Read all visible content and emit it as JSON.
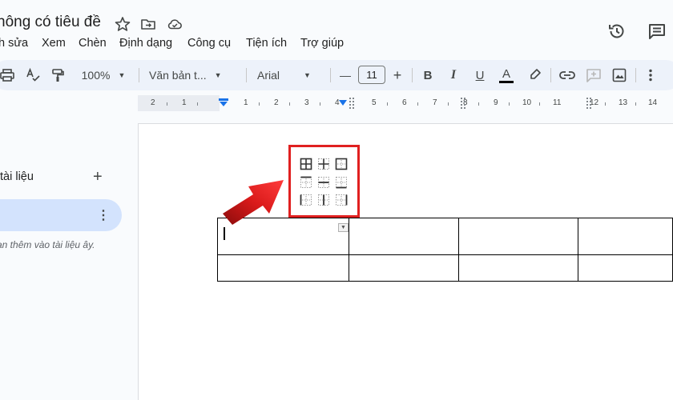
{
  "header": {
    "title": "hông có tiêu đề"
  },
  "menu": [
    {
      "label": "h sửa"
    },
    {
      "label": "Xem"
    },
    {
      "label": "Chèn"
    },
    {
      "label": "Định dạng"
    },
    {
      "label": "Công cụ"
    },
    {
      "label": "Tiện ích"
    },
    {
      "label": "Trợ giúp"
    }
  ],
  "toolbar": {
    "zoom": "100%",
    "style": "Văn bản t...",
    "font": "Arial",
    "font_size": "11",
    "minus": "—",
    "plus": "+",
    "bold": "B",
    "italic": "I",
    "underline": "U",
    "text_color_label": "A",
    "text_color": "#000000"
  },
  "ruler": {
    "numbers": [
      "2",
      "1",
      "1",
      "2",
      "3",
      "4",
      "5",
      "6",
      "7",
      "8",
      "9",
      "10",
      "11",
      "12",
      "13",
      "14"
    ]
  },
  "sidebar": {
    "section_label": "tài liệu",
    "add": "+",
    "more": "⋮",
    "hint": "ạn thêm vào tài liệu ây."
  },
  "colors": {
    "accent_blue": "#1a73e8",
    "highlight_red": "#e02020",
    "arrow_red": "#d91a1a",
    "toolbar_bg": "#edf2fa",
    "sidebar_tab_bg": "#d3e3fd"
  }
}
